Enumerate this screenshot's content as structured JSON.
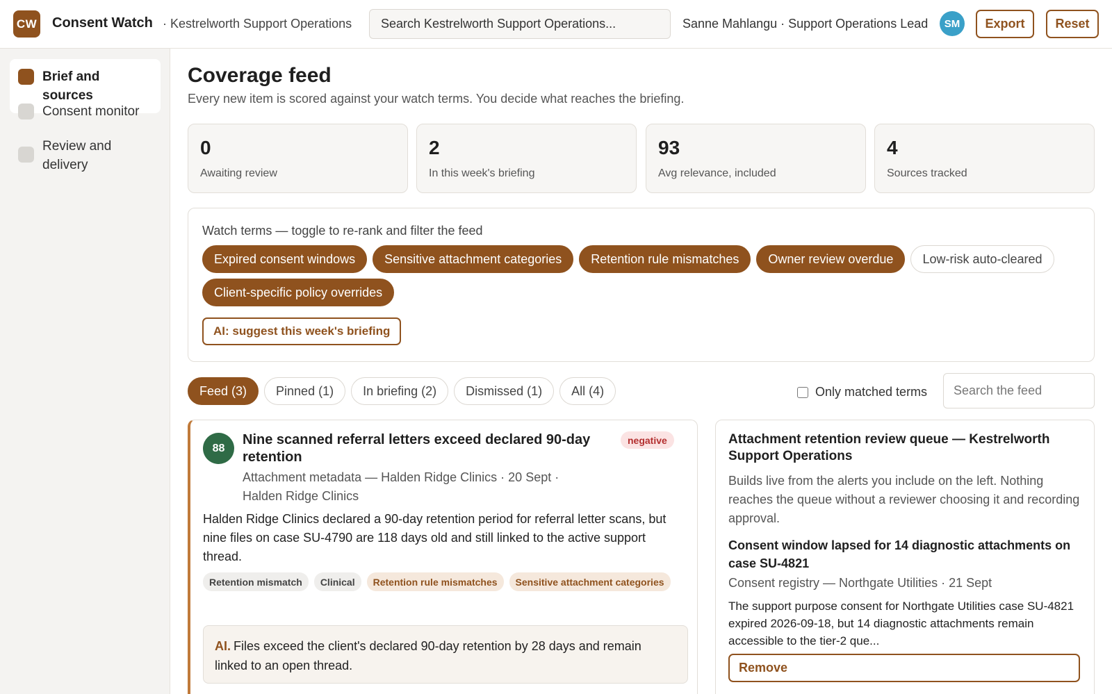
{
  "header": {
    "logo_text": "CW",
    "app_name": "Consent Watch",
    "org": "· Kestrelworth Support Operations",
    "search_placeholder": "Search Kestrelworth Support Operations...",
    "user": "Sanne Mahlangu · Support Operations Lead",
    "avatar_initials": "SM",
    "export_label": "Export",
    "reset_label": "Reset"
  },
  "sidebar": {
    "items": [
      {
        "label": "Brief and sources",
        "active": true
      },
      {
        "label": "Consent monitor",
        "active": false
      },
      {
        "label": "Review and delivery",
        "active": false
      }
    ]
  },
  "main": {
    "title": "Coverage feed",
    "subtitle": "Every new item is scored against your watch terms. You decide what reaches the briefing.",
    "stats": [
      {
        "value": "0",
        "label": "Awaiting review"
      },
      {
        "value": "2",
        "label": "In this week's briefing"
      },
      {
        "value": "93",
        "label": "Avg relevance, included"
      },
      {
        "value": "4",
        "label": "Sources tracked"
      }
    ],
    "watch_terms": {
      "title": "Watch terms — toggle to re-rank and filter the feed",
      "chips": [
        {
          "label": "Expired consent windows",
          "on": true
        },
        {
          "label": "Sensitive attachment categories",
          "on": true
        },
        {
          "label": "Retention rule mismatches",
          "on": true
        },
        {
          "label": "Owner review overdue",
          "on": true
        },
        {
          "label": "Low-risk auto-cleared",
          "on": false
        },
        {
          "label": "Client-specific policy overrides",
          "on": true
        }
      ],
      "ai_button": "AI: suggest this week's briefing"
    },
    "tabs": [
      {
        "label": "Feed (3)",
        "active": true
      },
      {
        "label": "Pinned (1)",
        "active": false
      },
      {
        "label": "In briefing (2)",
        "active": false
      },
      {
        "label": "Dismissed (1)",
        "active": false
      },
      {
        "label": "All (4)",
        "active": false
      }
    ],
    "only_matched_label": "Only matched terms",
    "feed_search_placeholder": "Search the feed",
    "feed_item": {
      "score": "88",
      "title": "Nine scanned referral letters exceed declared 90-day retention",
      "sentiment": "negative",
      "meta": "Attachment metadata — Halden Ridge Clinics · 20 Sept · Halden Ridge Clinics",
      "body": "Halden Ridge Clinics declared a 90-day retention period for referral letter scans, but nine files on case SU-4790 are 118 days old and still linked to the active support thread.",
      "tags": [
        {
          "label": "Retention mismatch",
          "warm": false
        },
        {
          "label": "Clinical",
          "warm": false
        },
        {
          "label": "Retention rule mismatches",
          "warm": true
        },
        {
          "label": "Sensitive attachment categories",
          "warm": true
        }
      ],
      "ai_label": "AI.",
      "ai_text": "Files exceed the client's declared 90-day retention by 28 days and remain linked to an open thread."
    },
    "review_panel": {
      "title": "Attachment retention review queue — Kestrelworth Support Operations",
      "subtitle": "Builds live from the alerts you include on the left. Nothing reaches the queue without a reviewer choosing it and recording approval.",
      "item_title": "Consent window lapsed for 14 diagnostic attachments on case SU-4821",
      "item_meta": "Consent registry — Northgate Utilities · 21 Sept",
      "item_body": "The support purpose consent for Northgate Utilities case SU-4821 expired 2026-09-18, but 14 diagnostic attachments remain accessible to the tier-2 que...",
      "remove_label": "Remove"
    }
  },
  "colors": {
    "accent": "#8f521e",
    "score_green": "#2f6b46",
    "avatar_blue": "#3aa0c8",
    "negative_red": "#b32f2f"
  }
}
